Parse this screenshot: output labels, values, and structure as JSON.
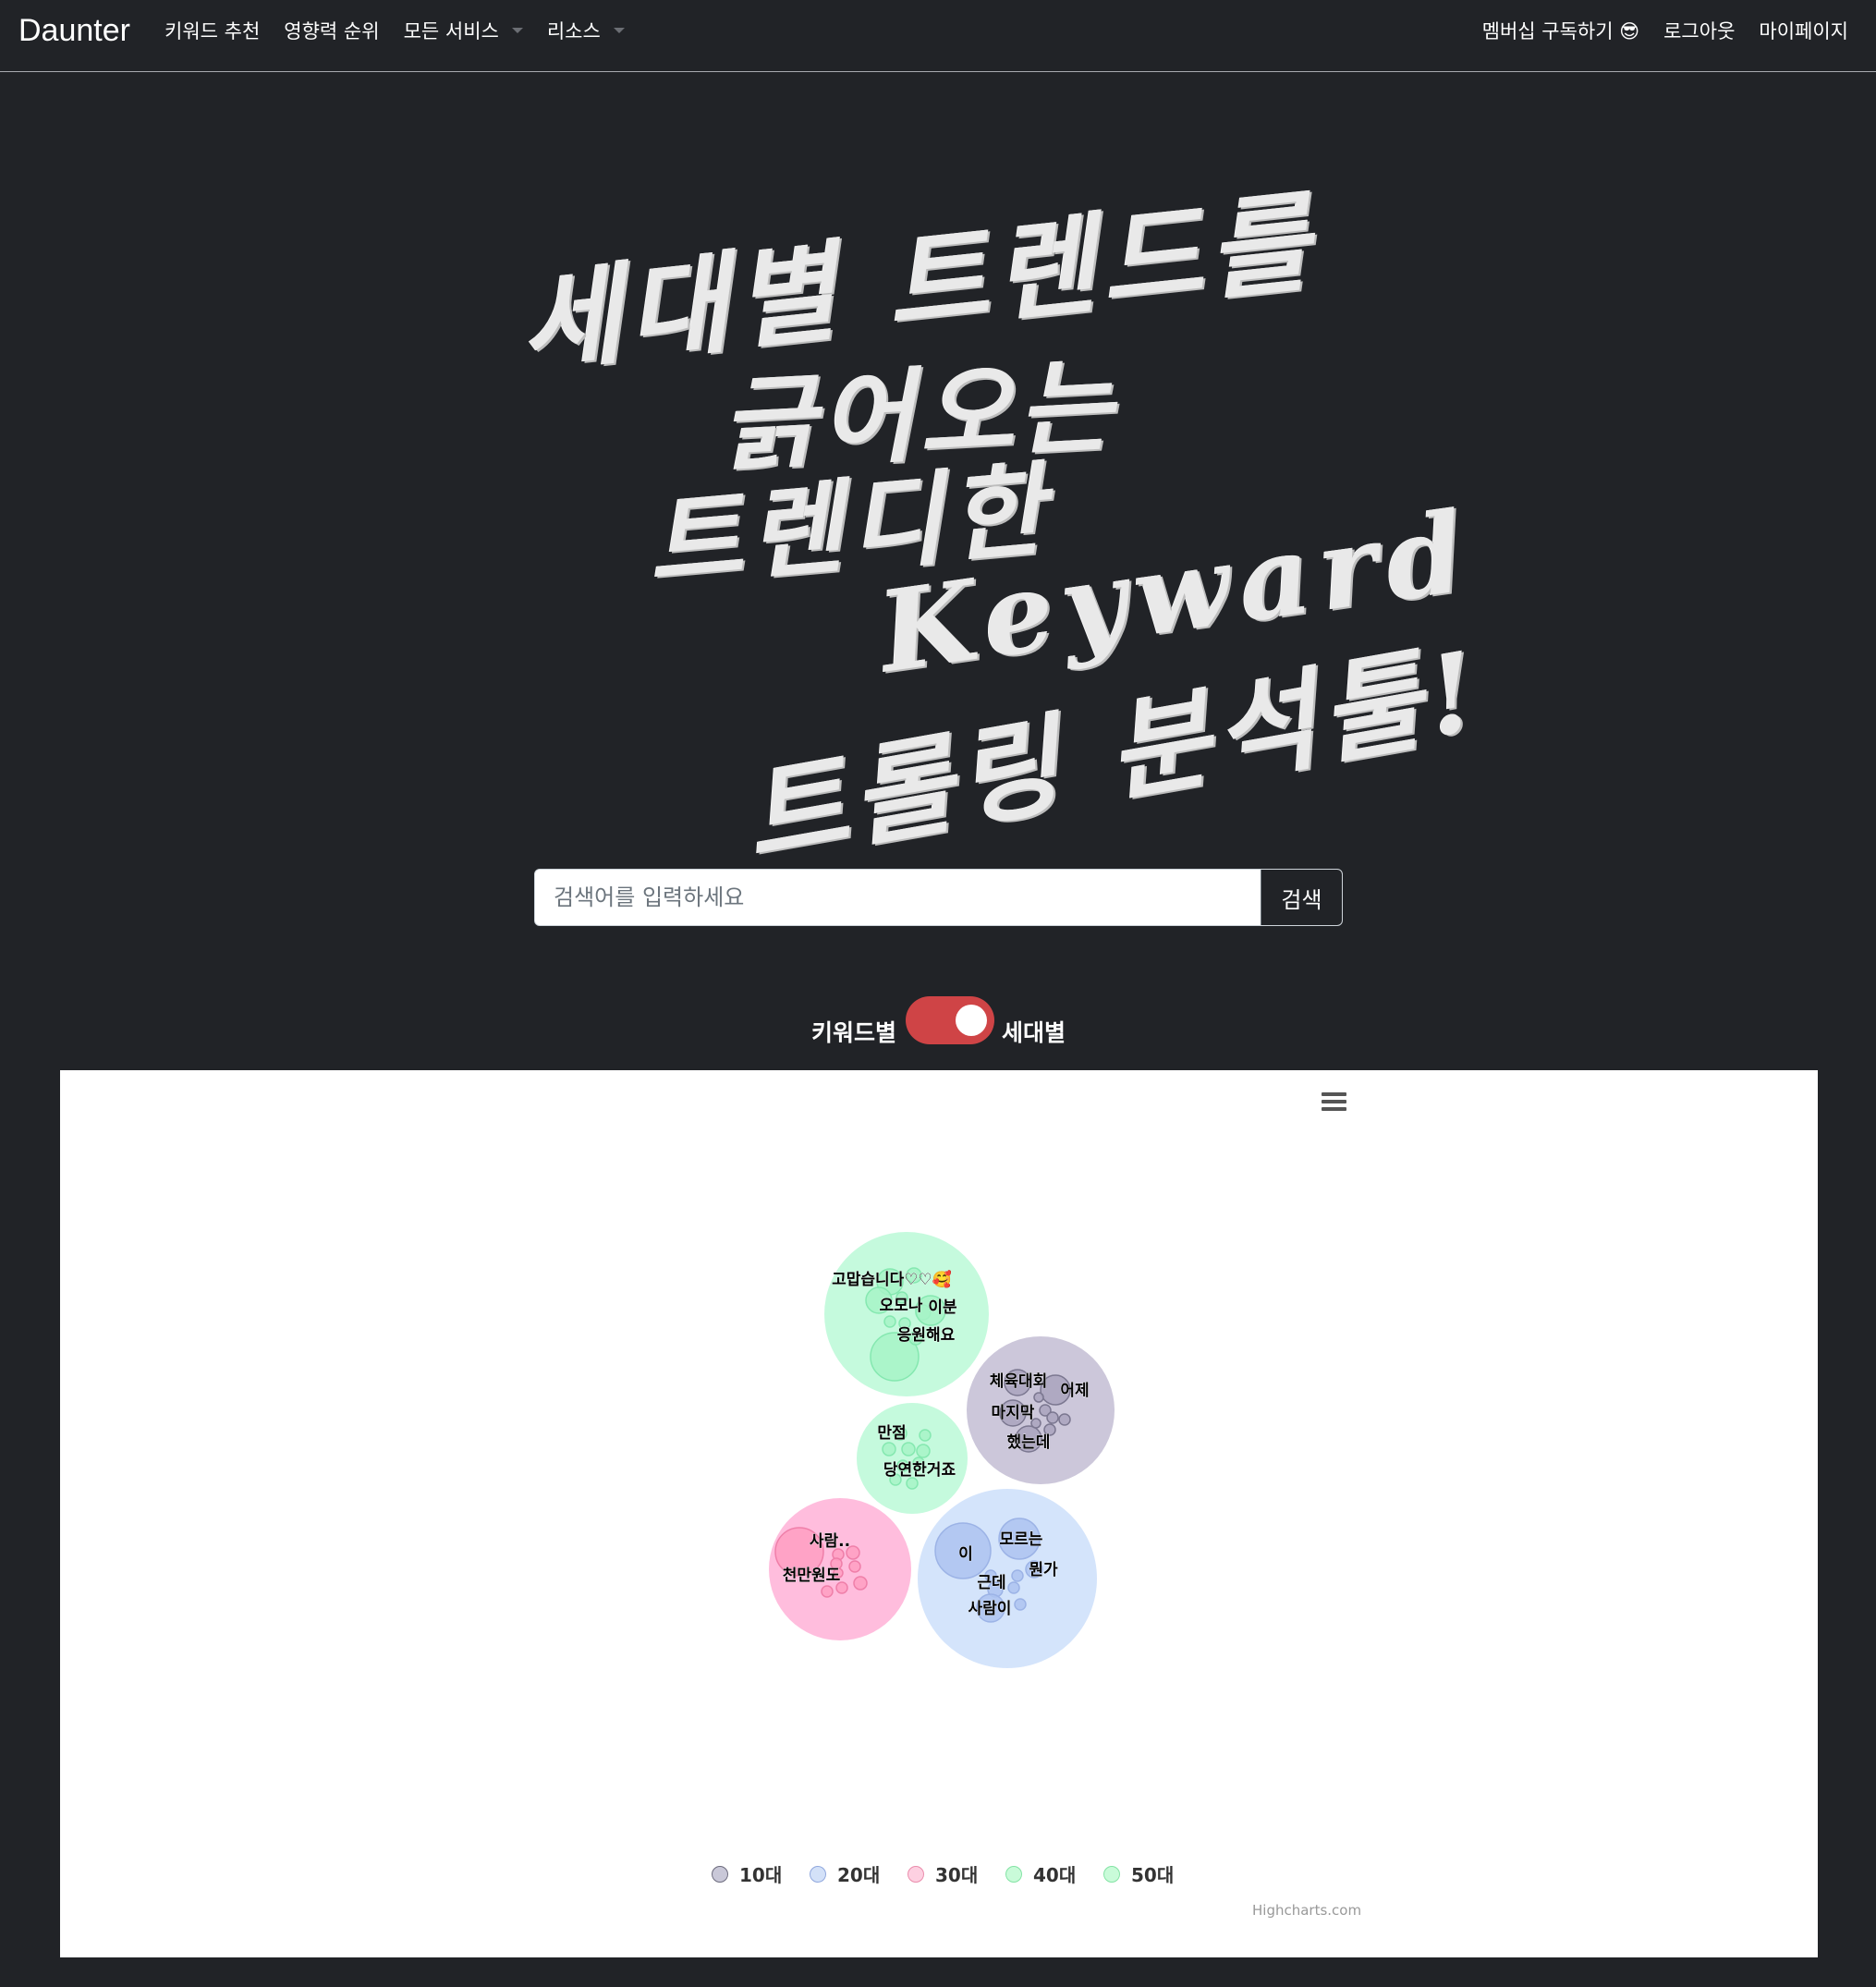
{
  "navbar": {
    "brand": "Daunter",
    "left_items": [
      "키워드 추천",
      "영향력 순위",
      "모든 서비스",
      "리소스"
    ],
    "right_items": [
      "멤버십 구독하기 😎",
      "로그아웃",
      "마이페이지"
    ]
  },
  "hero": {
    "lines": [
      "세대별 트렌드를",
      "긁어오는",
      "트렌디한",
      "Keyward",
      "트롤링 분석툴!"
    ]
  },
  "search": {
    "placeholder": "검색어를 입력하세요",
    "button_label": "검색"
  },
  "toggle": {
    "left_label": "키워드별",
    "right_label": "세대별",
    "state": "세대별"
  },
  "chart_data": {
    "type": "packedbubble",
    "series": [
      {
        "name": "10대",
        "color": "#434348",
        "labels": [
          "체육대회",
          "어제",
          "마지막",
          "했는데"
        ]
      },
      {
        "name": "20대",
        "color": "#7cb5ec",
        "labels": [
          "이",
          "모르는",
          "근데",
          "뭔가",
          "사람이"
        ]
      },
      {
        "name": "30대",
        "color": "#f7a35c",
        "labels": [
          "사람..",
          "천만원도"
        ]
      },
      {
        "name": "40대",
        "color": "#90ed7d",
        "labels": [
          "만점",
          "당연한거죠"
        ]
      },
      {
        "name": "50대",
        "color": "#90ed7d",
        "labels": [
          "고맙습니다♡♡🥰",
          "오모나",
          "이분",
          "응원해요"
        ]
      }
    ],
    "legend_position": "bottom",
    "credits": "Highcharts.com"
  }
}
